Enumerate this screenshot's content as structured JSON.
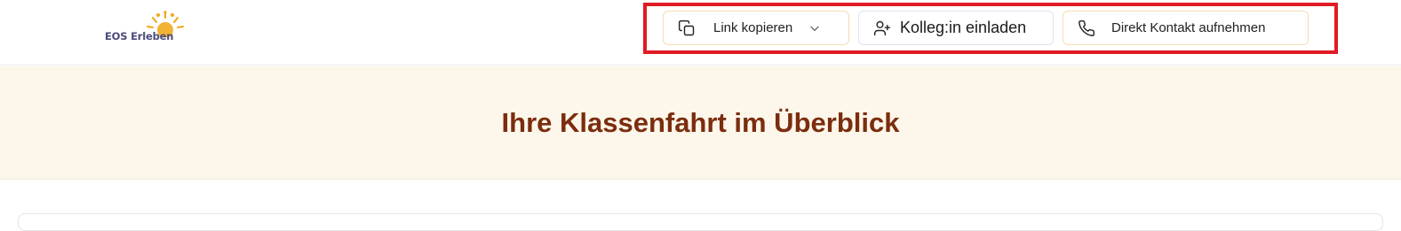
{
  "brand": {
    "logo_text": "EOS Erleben"
  },
  "header": {
    "copy_link": {
      "label": "Link kopieren",
      "icon": "copy-icon",
      "chevron": "chevron-down-icon"
    },
    "invite_colleague": {
      "label": "Kolleg:in einladen",
      "icon": "user-plus-icon"
    },
    "direct_contact": {
      "label": "Direkt Kontakt aufnehmen",
      "icon": "phone-icon"
    }
  },
  "hero": {
    "title": "Ihre Klassenfahrt im Überblick"
  },
  "colors": {
    "accent_border": "#f6dcb5",
    "hero_background": "#fdf7eb",
    "hero_title": "#7b2d0e",
    "highlight_box": "#e01b24"
  }
}
